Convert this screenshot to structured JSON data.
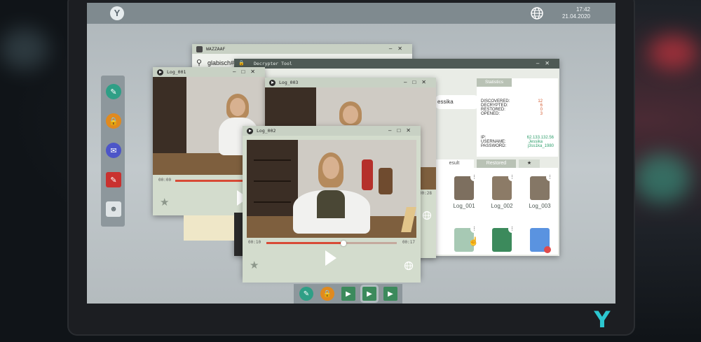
{
  "topbar": {
    "date": "21.04.2020",
    "time": "17:42"
  },
  "windows": {
    "wazzaaf": {
      "title": "WAZZAAF",
      "search_value": "glabisch#7"
    },
    "decrypter": {
      "title": "Decrypter Tool",
      "user_field_value": "essika",
      "statistics_tab": "Statistics",
      "stats": [
        {
          "label": "DISCOVERED:",
          "value": "12"
        },
        {
          "label": "DECRYPTED:",
          "value": "6"
        },
        {
          "label": "RESTORED:",
          "value": "0"
        },
        {
          "label": "OPENED:",
          "value": "3"
        }
      ],
      "ip_label": "IP:",
      "ip_value": "62.133.132.56",
      "username_label": "USERNAME:",
      "username_value": "Jessika",
      "password_label": "PASSWORD:",
      "password_value": "j3ss1ka_1980",
      "tabs": [
        "esult",
        "Restored",
        "★"
      ],
      "files": [
        {
          "name": "Log_001"
        },
        {
          "name": "Log_002"
        },
        {
          "name": "Log_003"
        }
      ]
    },
    "log001": {
      "title": "Log_001",
      "time": "00:00",
      "progress": 0
    },
    "log003": {
      "title": "Log_003",
      "time_end": "00:28"
    },
    "log002": {
      "title": "Log_002",
      "time_current": "00:10",
      "time_end": "00:17",
      "progress": 0.59
    }
  },
  "colors": {
    "accent_red": "#d84a36",
    "stat_orange": "#d3592e",
    "cred_green": "#2f9f6c",
    "file_green": "#3c8a5c"
  },
  "dock": {
    "icons": [
      "chat-icon",
      "lock-icon",
      "mail-icon",
      "notes-icon",
      "contact-icon"
    ]
  },
  "taskbar": {
    "icons": [
      "chat-icon",
      "lock-icon",
      "video-file-icon",
      "video-file-icon",
      "video-file-icon"
    ]
  },
  "brand_logo": "Y"
}
